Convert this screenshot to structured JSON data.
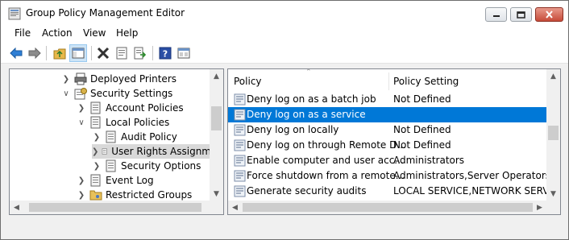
{
  "window": {
    "title": "Group Policy Management Editor"
  },
  "menu": {
    "items": [
      "File",
      "Action",
      "View",
      "Help"
    ]
  },
  "toolbar": {
    "buttons": [
      "back-icon",
      "forward-icon",
      "up-folder-icon",
      "show-hide-tree-icon",
      "delete-icon",
      "properties-icon",
      "export-list-icon",
      "help-icon",
      "extended-view-icon"
    ]
  },
  "tree": {
    "items": [
      {
        "label": "Deployed Printers",
        "icon": "printer-icon",
        "expander": "collapsed"
      },
      {
        "label": "Security Settings",
        "icon": "security-icon",
        "expander": "expanded"
      },
      {
        "label": "Account Policies",
        "icon": "policy-icon",
        "expander": "collapsed"
      },
      {
        "label": "Local Policies",
        "icon": "policy-icon",
        "expander": "expanded"
      },
      {
        "label": "Audit Policy",
        "icon": "policy-icon",
        "expander": "collapsed"
      },
      {
        "label": "User Rights Assignm",
        "icon": "policy-icon",
        "expander": "collapsed",
        "selected": true
      },
      {
        "label": "Security Options",
        "icon": "policy-icon",
        "expander": "collapsed"
      },
      {
        "label": "Event Log",
        "icon": "policy-icon",
        "expander": "collapsed"
      },
      {
        "label": "Restricted Groups",
        "icon": "folder-icon",
        "expander": "collapsed"
      }
    ]
  },
  "list": {
    "columns": [
      "Policy",
      "Policy Setting"
    ],
    "rows": [
      {
        "policy": "Deny log on as a batch job",
        "setting": "Not Defined"
      },
      {
        "policy": "Deny log on as a service",
        "setting": "",
        "selected": true
      },
      {
        "policy": "Deny log on locally",
        "setting": "Not Defined"
      },
      {
        "policy": "Deny log on through Remote D...",
        "setting": "Not Defined"
      },
      {
        "policy": "Enable computer and user acc...",
        "setting": "Administrators"
      },
      {
        "policy": "Force shutdown from a remote...",
        "setting": "Administrators,Server Operators"
      },
      {
        "policy": "Generate security audits",
        "setting": "LOCAL SERVICE,NETWORK SERVICE"
      }
    ]
  },
  "colors": {
    "selection": "#0078d7",
    "tree_selection": "#d9d9d9",
    "window_bg": "#f0f0f0"
  }
}
